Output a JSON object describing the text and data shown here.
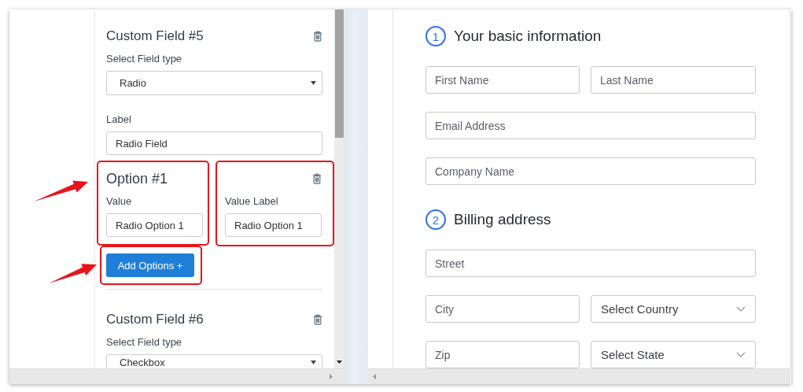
{
  "editor": {
    "custom_fields": [
      {
        "title": "Custom Field #5",
        "type_caption": "Select Field type",
        "type_value": "Radio",
        "label_caption": "Label",
        "label_value": "Radio Field",
        "options": [
          {
            "title": "Option #1",
            "value_caption": "Value",
            "value": "Radio Option 1",
            "value_label_caption": "Value Label",
            "value_label": "Radio Option 1"
          }
        ],
        "add_button": "Add Options +"
      },
      {
        "title": "Custom Field #6",
        "type_caption": "Select Field type",
        "type_value": "Checkbox"
      }
    ]
  },
  "preview": {
    "sections": [
      {
        "number": "1",
        "title": "Your basic information",
        "rows": [
          [
            {
              "kind": "input",
              "placeholder": "First Name"
            },
            {
              "kind": "input",
              "placeholder": "Last Name"
            }
          ],
          [
            {
              "kind": "input",
              "placeholder": "Email Address"
            }
          ],
          [
            {
              "kind": "input",
              "placeholder": "Company Name"
            }
          ]
        ]
      },
      {
        "number": "2",
        "title": "Billing address",
        "rows": [
          [
            {
              "kind": "input",
              "placeholder": "Street"
            }
          ],
          [
            {
              "kind": "input",
              "placeholder": "City"
            },
            {
              "kind": "select",
              "text": "Select Country"
            }
          ],
          [
            {
              "kind": "input",
              "placeholder": "Zip"
            },
            {
              "kind": "select",
              "text": "Select State"
            }
          ]
        ]
      }
    ]
  }
}
